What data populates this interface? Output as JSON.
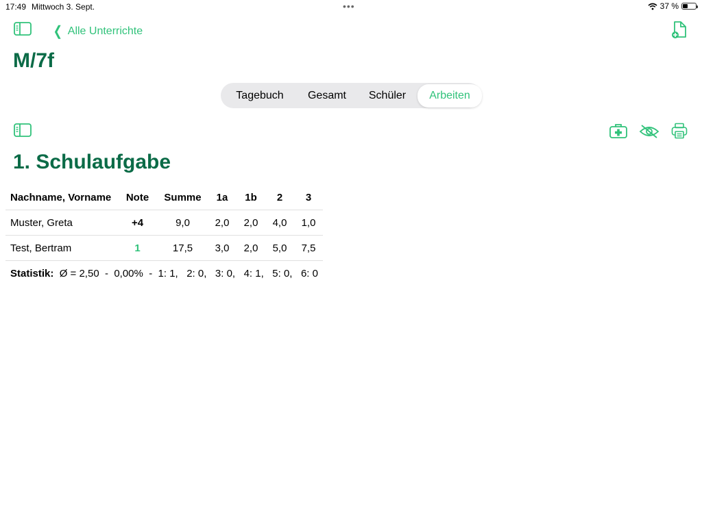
{
  "status": {
    "time": "17:49",
    "date": "Mittwoch 3. Sept.",
    "battery": "37 %",
    "dots": "•••"
  },
  "nav": {
    "back_label": "Alle Unterrichte"
  },
  "page_title": "M/7f",
  "tabs": [
    {
      "label": "Tagebuch"
    },
    {
      "label": "Gesamt"
    },
    {
      "label": "Schüler"
    },
    {
      "label": "Arbeiten"
    }
  ],
  "section_title": "1. Schulaufgabe",
  "table": {
    "headers": [
      "Nachname, Vorname",
      "Note",
      "Summe",
      "1a",
      "1b",
      "2",
      "3"
    ],
    "rows": [
      [
        "Muster, Greta",
        "+4",
        "9,0",
        "2,0",
        "2,0",
        "4,0",
        "1,0"
      ],
      [
        "Test, Bertram",
        "1",
        "17,5",
        "3,0",
        "2,0",
        "5,0",
        "7,5"
      ]
    ],
    "stats_label": "Statistik:",
    "stats_value": "Ø = 2,50  -  0,00%  -  1: 1,   2: 0,   3: 0,   4: 1,   5: 0,   6: 0"
  },
  "colors": {
    "accent": "#30c27a",
    "title": "#0b6b47"
  },
  "icons": [
    "sidebar-icon",
    "add-document-icon",
    "first-aid-icon",
    "hidden-eye-icon",
    "print-icon"
  ]
}
